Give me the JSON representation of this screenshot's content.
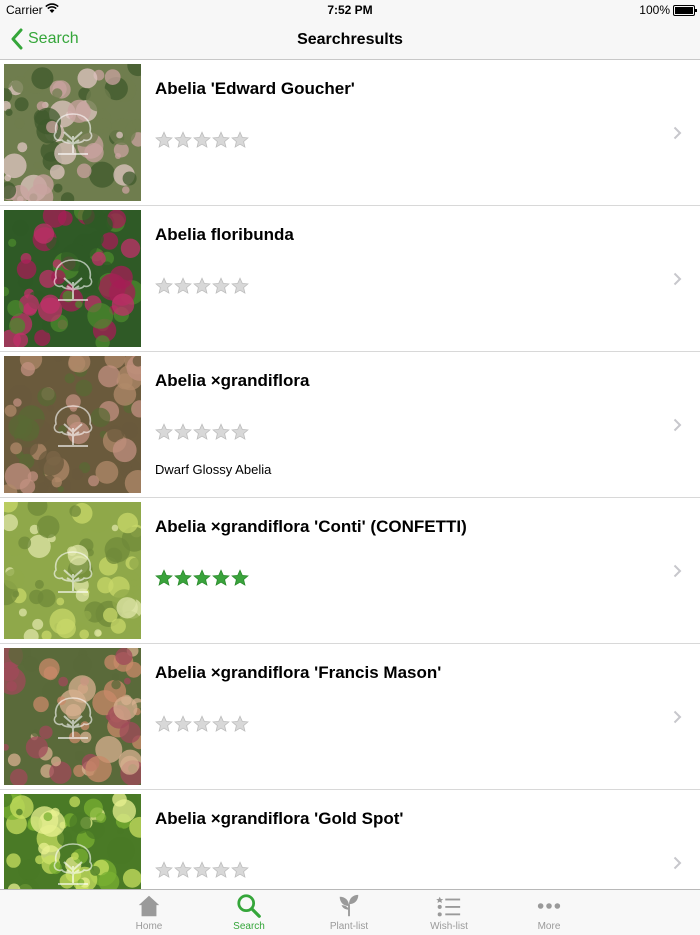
{
  "status_bar": {
    "carrier": "Carrier",
    "time": "7:52 PM",
    "battery": "100%"
  },
  "nav": {
    "back_label": "Search",
    "title": "Searchresults"
  },
  "results": [
    {
      "name": "Abelia 'Edward Goucher'",
      "rating": 0,
      "common_name": "",
      "photo": {
        "base": "#6f7d4e",
        "c1": "#c9a3a0",
        "c2": "#3f5a2c",
        "c3": "#e0c7c3"
      }
    },
    {
      "name": "Abelia floribunda",
      "rating": 0,
      "common_name": "",
      "photo": {
        "base": "#2f5a26",
        "c1": "#c0306a",
        "c2": "#4c8a2e",
        "c3": "#a61d55"
      }
    },
    {
      "name": "Abelia ×grandiflora",
      "rating": 0,
      "common_name": "Dwarf Glossy Abelia",
      "photo": {
        "base": "#6a5a3c",
        "c1": "#b08a6a",
        "c2": "#5a6a34",
        "c3": "#c29080"
      }
    },
    {
      "name": "Abelia ×grandiflora 'Conti' (CONFETTI)",
      "rating": 5,
      "common_name": "",
      "photo": {
        "base": "#8fa84a",
        "c1": "#c8d86a",
        "c2": "#6f8a3a",
        "c3": "#dfe6a8"
      }
    },
    {
      "name": "Abelia ×grandiflora 'Francis Mason'",
      "rating": 0,
      "common_name": "",
      "photo": {
        "base": "#5a6a3a",
        "c1": "#c98a6a",
        "c2": "#a04a5a",
        "c3": "#d8b090"
      }
    },
    {
      "name": "Abelia ×grandiflora 'Gold Spot'",
      "rating": 0,
      "common_name": "",
      "photo": {
        "base": "#4a7a26",
        "c1": "#c8e060",
        "c2": "#7ab032",
        "c3": "#e8f090"
      }
    }
  ],
  "tabs": [
    {
      "label": "Home",
      "icon": "home-icon",
      "active": false
    },
    {
      "label": "Search",
      "icon": "search-icon",
      "active": true
    },
    {
      "label": "Plant-list",
      "icon": "plant-icon",
      "active": false
    },
    {
      "label": "Wish-list",
      "icon": "wishlist-icon",
      "active": false
    },
    {
      "label": "More",
      "icon": "more-icon",
      "active": false
    }
  ],
  "colors": {
    "accent": "#35a63a",
    "star_empty": "#d8d8d8",
    "star_filled": "#3aa33c",
    "tab_inactive": "#9a9a9a"
  }
}
